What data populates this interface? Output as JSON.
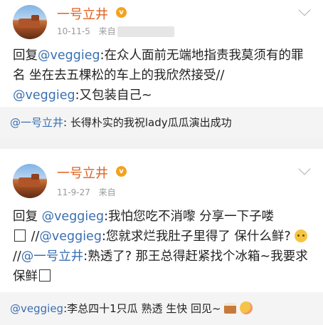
{
  "posts": [
    {
      "author": "一号立井",
      "vip_badge": "v",
      "time": "10-11-5",
      "source_prefix": "来自",
      "body": {
        "reply_word": "回复",
        "mention1": "@veggieg",
        "text1": ":在众人面前无端地指责我莫须有的罪名  坐在去五棵松的车上的我欣然接受//",
        "mention2": "@veggieg",
        "text2": ":又包装自己~"
      },
      "repost": {
        "mention": "@一号立井",
        "text": ": 长得朴实的我祝lady瓜瓜演出成功"
      }
    },
    {
      "author": "一号立井",
      "vip_badge": "v",
      "time": "11-9-27",
      "source_prefix": "来自",
      "body": {
        "reply_word": "回复 ",
        "mention1": "@veggieg",
        "text1": ":我怕您吃不消嚟 分享一下子喽",
        "sep1": " //",
        "mention2": "@veggieg",
        "text2": ":您就求烂我肚子里得了 保什么鲜?",
        "sep2": " //",
        "mention3": "@一号立井",
        "text3": ":熟透了? 那王总得赶紧找个冰箱~我要求保鲜"
      },
      "repost": {
        "mention": "@veggieg",
        "text": ":李总四十1只瓜 熟透 生快 回见~"
      }
    }
  ],
  "icons": {
    "chevron": "chevron-down-icon",
    "vip": "vip-badge-icon",
    "emoji_smile": "grin-emoji-icon",
    "emoji_cake": "cake-emoji-icon",
    "emoji_blush": "blush-emoji-icon"
  },
  "colors": {
    "author": "#e06222",
    "mention": "#3a6fb0",
    "meta": "#9a9a9a",
    "repost_bg": "#f4f4f4"
  }
}
